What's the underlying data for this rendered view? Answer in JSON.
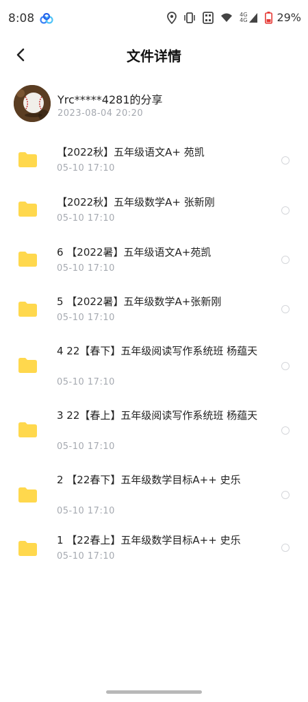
{
  "status_bar": {
    "time": "8:08",
    "network": "4G",
    "battery": "29%"
  },
  "header": {
    "title": "文件详情"
  },
  "sharer": {
    "name": "Yrc*****4281的分享",
    "time": "2023-08-04  20:20"
  },
  "files": [
    {
      "name": "【2022秋】五年级语文A+ 苑凯",
      "date": "05-10  17:10"
    },
    {
      "name": "【2022秋】五年级数学A+ 张新刚",
      "date": "05-10  17:10"
    },
    {
      "name": "6 【2022暑】五年级语文A+苑凯",
      "date": "05-10  17:10"
    },
    {
      "name": "5 【2022暑】五年级数学A+张新刚",
      "date": "05-10  17:10"
    },
    {
      "name": "4 22【春下】五年级阅读写作系统班 杨蕴天",
      "date": "05-10  17:10"
    },
    {
      "name": "3 22【春上】五年级阅读写作系统班 杨蕴天",
      "date": "05-10  17:10"
    },
    {
      "name": "2 【22春下】五年级数学目标A++  史乐",
      "date": "05-10  17:10"
    },
    {
      "name": "1 【22春上】五年级数学目标A++  史乐",
      "date": "05-10  17:10"
    }
  ],
  "colors": {
    "folder": "#FFD84D",
    "secondary_text": "#a5a9b0",
    "accent": "#3b82f6"
  },
  "icons": [
    "back-arrow-icon",
    "folder-icon",
    "location-icon",
    "vibrate-icon",
    "wifi-icon",
    "signal-icon",
    "battery-icon"
  ]
}
